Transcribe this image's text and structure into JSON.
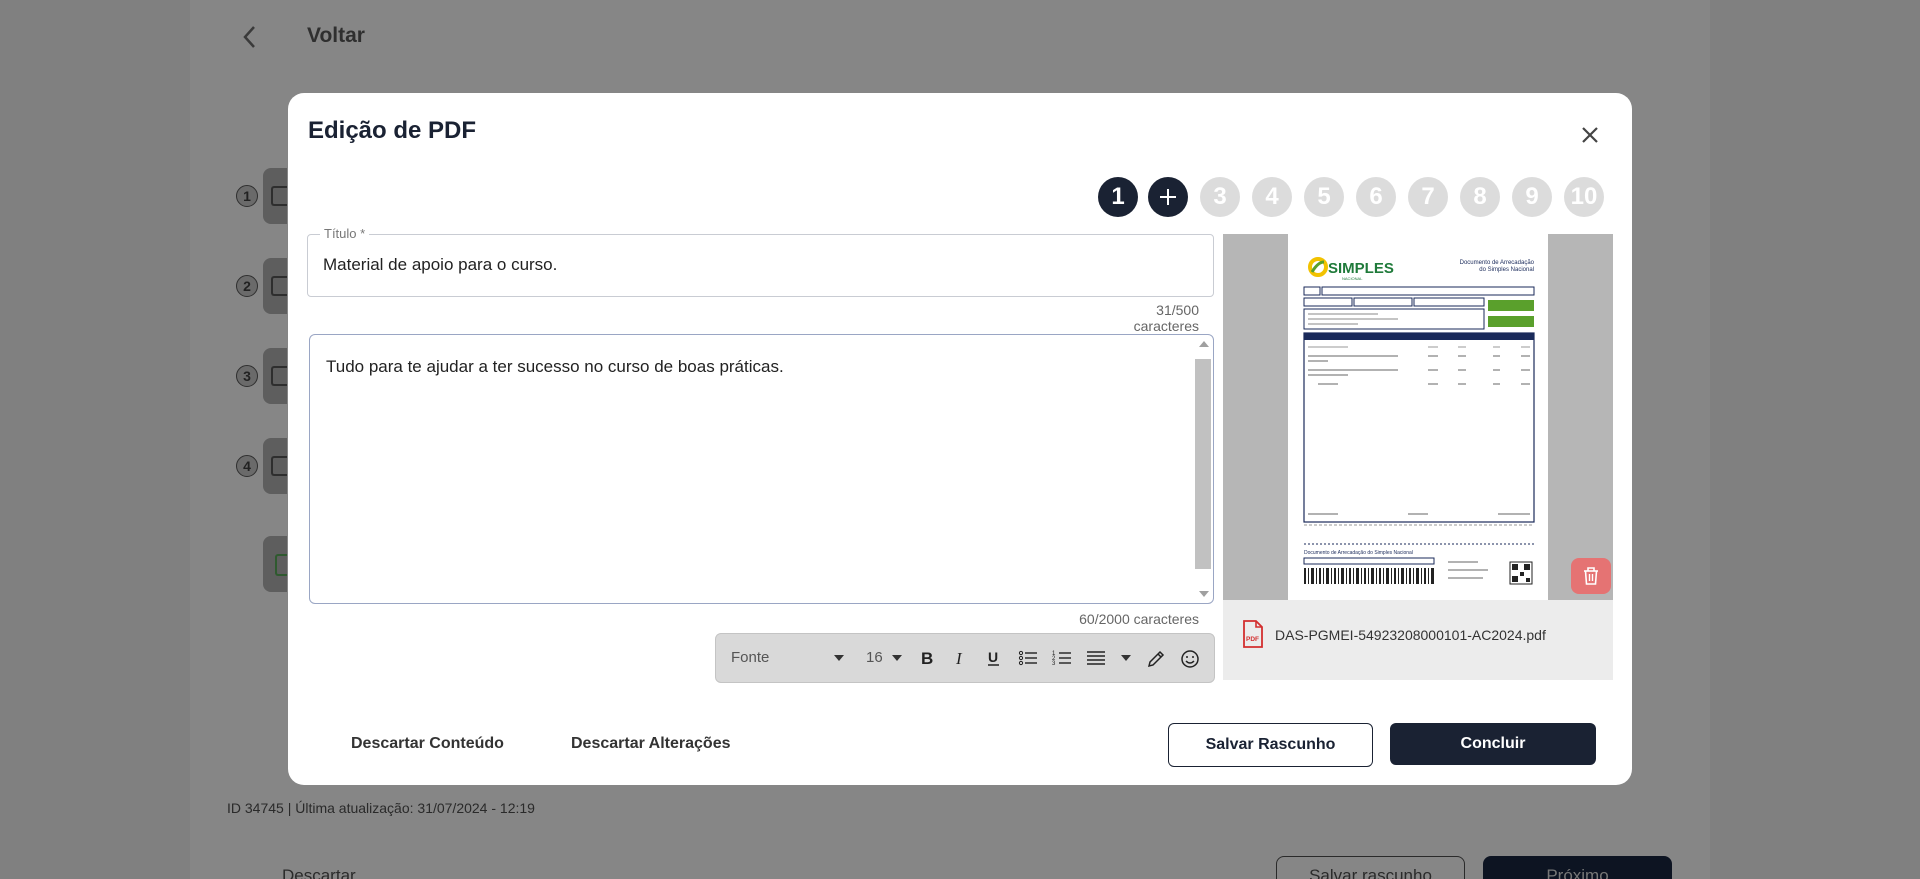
{
  "background": {
    "back_label": "Voltar",
    "step_numbers": [
      "1",
      "2",
      "3",
      "4"
    ],
    "meta": "ID 34745 | Última atualização: 31/07/2024 - 12:19",
    "discard_label": "Descartar",
    "save_draft_label": "Salvar rascunho",
    "next_label": "Próximo"
  },
  "modal": {
    "title": "Edição de PDF",
    "steps": [
      "1",
      "+",
      "3",
      "4",
      "5",
      "6",
      "7",
      "8",
      "9",
      "10"
    ],
    "title_field": {
      "label": "Título",
      "required_mark": "*",
      "value": "Material de apoio para o curso.",
      "count": "31/500 caracteres"
    },
    "description": {
      "value": "Tudo para te ajudar a ter sucesso no curso de boas práticas.",
      "count": "60/2000 caracteres"
    },
    "toolbar": {
      "font_label": "Fonte",
      "size_value": "16",
      "buttons": [
        "bold-icon",
        "italic-icon",
        "underline-icon",
        "bullet-list-icon",
        "numbered-list-icon",
        "align-icon",
        "pencil-icon",
        "emoji-icon"
      ]
    },
    "preview": {
      "file_name": "DAS-PGMEI-54923208000101-AC2024.pdf",
      "doc_brand": "SIMPLES",
      "doc_brand_sub": "NACIONAL",
      "doc_heading_line1": "Documento de Arrecadação",
      "doc_heading_line2": "do Simples Nacional",
      "doc_footer_heading": "Documento de Arrecadação do Simples Nacional"
    },
    "footer": {
      "discard_content": "Descartar Conteúdo",
      "discard_changes": "Descartar Alterações",
      "save_draft": "Salvar Rascunho",
      "conclude": "Concluir"
    }
  },
  "colors": {
    "primary": "#1a2233",
    "overlay": "#808080",
    "delete": "#e57373",
    "pdf_red": "#d32f2f",
    "doc_green": "#5aa02c"
  }
}
